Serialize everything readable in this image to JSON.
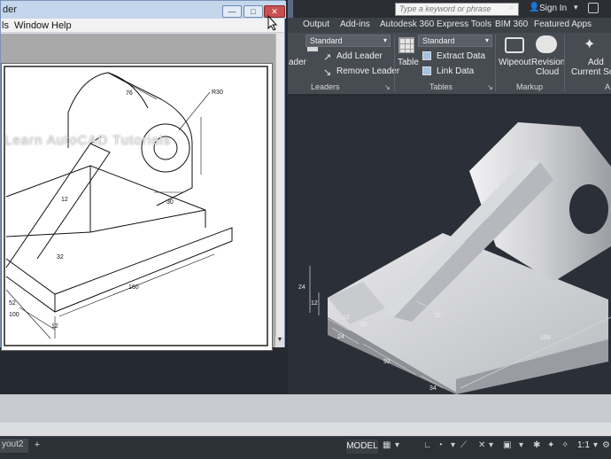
{
  "title_bar": {
    "search_placeholder": "Type a keyword or phrase",
    "sign_in": "Sign In"
  },
  "ribbon_tabs": [
    "Output",
    "Add-ins",
    "Autodesk 360",
    "Express Tools",
    "BIM 360",
    "Featured Apps"
  ],
  "ribbon": {
    "leaders": {
      "style_value": "Standard",
      "partial_button": "ader",
      "add_leader": "Add Leader",
      "remove_leader": "Remove Leader",
      "panel_label": "Leaders"
    },
    "tables": {
      "style_value": "Standard",
      "table_button": "Table",
      "extract_data": "Extract Data",
      "link_data": "Link Data",
      "panel_label": "Tables"
    },
    "markup": {
      "wipeout": "Wipeout",
      "revision_cloud_1": "Revision",
      "revision_cloud_2": "Cloud",
      "panel_label": "Markup"
    },
    "partial_panel": {
      "add_current_scale_1": "Add",
      "add_current_scale_2": "Current Scal",
      "panel_label": "A"
    }
  },
  "viewer_window": {
    "title": "der",
    "menu": [
      "ls",
      "Window",
      "Help"
    ],
    "buttons": {
      "minimize": "—",
      "maximize": "□",
      "close": "✕"
    }
  },
  "drawing_dims": {
    "ref_r30": "R30",
    "ref_76": "76",
    "ref_30": "30",
    "ref_12": "12",
    "ref_32": "32",
    "ref_52": "52",
    "ref_100": "100",
    "ref_160": "160",
    "ref_12b": "12"
  },
  "model_dims": {
    "d24a": "24",
    "d12": "12",
    "d10": "10",
    "d30": "30",
    "d52": "52",
    "d24b": "24",
    "d92": "92",
    "d34": "34",
    "d160": "160",
    "d26": "26"
  },
  "watermark": "Learn AutoCAD Tutorials",
  "status_bar": {
    "layout_tab": "yout2",
    "add_tab": "+",
    "model": "MODEL",
    "zoom": "1:1"
  },
  "colors": {
    "ribbon_bg": "#474b52",
    "viewport_bg": "#2b2f38",
    "window_frame": "#c4d6ec",
    "close_button": "#c75050"
  }
}
